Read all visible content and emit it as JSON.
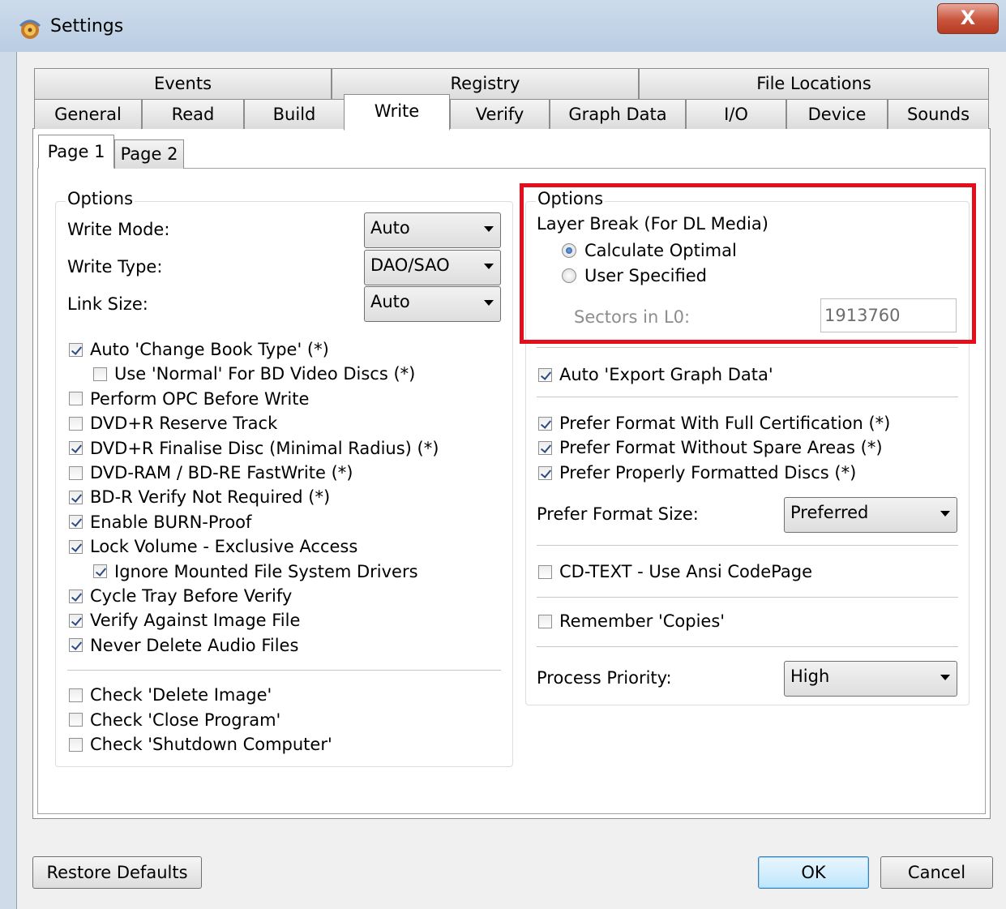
{
  "window": {
    "title": "Settings",
    "close_label": "X"
  },
  "tabs": {
    "row1": [
      "Events",
      "Registry",
      "File Locations"
    ],
    "row2": [
      "General",
      "Read",
      "Build",
      "Write",
      "Verify",
      "Graph Data",
      "I/O",
      "Device",
      "Sounds"
    ],
    "active": "Write"
  },
  "subtabs": [
    "Page 1",
    "Page 2"
  ],
  "left": {
    "legend": "Options",
    "write_mode": {
      "label": "Write Mode:",
      "value": "Auto"
    },
    "write_type": {
      "label": "Write Type:",
      "value": "DAO/SAO"
    },
    "link_size": {
      "label": "Link Size:",
      "value": "Auto"
    },
    "checks": [
      {
        "label": "Auto 'Change Book Type' (*)",
        "checked": true
      },
      {
        "label": "Use 'Normal' For BD Video Discs (*)",
        "checked": false
      },
      {
        "label": "Perform OPC Before Write",
        "checked": false
      },
      {
        "label": "DVD+R Reserve Track",
        "checked": false
      },
      {
        "label": "DVD+R Finalise Disc (Minimal Radius) (*)",
        "checked": true
      },
      {
        "label": "DVD-RAM / BD-RE FastWrite (*)",
        "checked": false
      },
      {
        "label": "BD-R Verify Not Required (*)",
        "checked": true
      },
      {
        "label": "Enable BURN-Proof",
        "checked": true
      },
      {
        "label": "Lock Volume - Exclusive Access",
        "checked": true
      },
      {
        "label": "Ignore Mounted File System Drivers",
        "checked": true
      },
      {
        "label": "Cycle Tray Before Verify",
        "checked": true
      },
      {
        "label": "Verify Against Image File",
        "checked": true
      },
      {
        "label": "Never Delete Audio Files",
        "checked": true
      }
    ],
    "checks2": [
      {
        "label": "Check 'Delete Image'",
        "checked": false
      },
      {
        "label": "Check 'Close Program'",
        "checked": false
      },
      {
        "label": "Check 'Shutdown Computer'",
        "checked": false
      }
    ]
  },
  "right": {
    "legend": "Options",
    "layer_break": "Layer Break (For DL Media)",
    "radio_optimal": "Calculate Optimal",
    "radio_user": "User Specified",
    "sectors_label": "Sectors in L0:",
    "sectors_value": "1913760",
    "export_graph": {
      "label": "Auto 'Export Graph Data'",
      "checked": true
    },
    "prefer_full_cert": {
      "label": "Prefer Format With Full Certification (*)",
      "checked": true
    },
    "prefer_no_spare": {
      "label": "Prefer Format Without Spare Areas (*)",
      "checked": true
    },
    "prefer_properly": {
      "label": "Prefer Properly Formatted Discs (*)",
      "checked": true
    },
    "format_size": {
      "label": "Prefer Format Size:",
      "value": "Preferred"
    },
    "cd_text": {
      "label": "CD-TEXT - Use Ansi CodePage",
      "checked": false
    },
    "remember_copies": {
      "label": "Remember 'Copies'",
      "checked": false
    },
    "priority": {
      "label": "Process Priority:",
      "value": "High"
    }
  },
  "buttons": {
    "restore": "Restore Defaults",
    "ok": "OK",
    "cancel": "Cancel"
  },
  "colors": {
    "highlight": "#e3101c",
    "window_bg": "#f0f0f0",
    "titlebar": "#c4d5e8"
  }
}
